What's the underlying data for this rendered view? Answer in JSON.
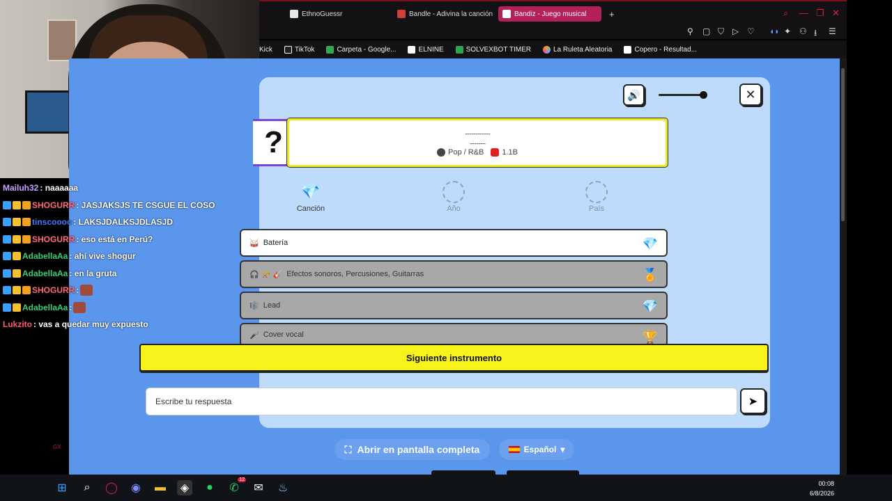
{
  "browser": {
    "tabs": [
      {
        "label": "EthnoGuessr",
        "color": "#e8e8e8"
      },
      {
        "label": "Bandle - Adivina la canción",
        "color": "#d04040"
      },
      {
        "label": "Bandiz - Juego musical",
        "color": "#ffffff"
      }
    ],
    "new_tab_symbol": "+",
    "bookmarks": [
      {
        "label": "Kick",
        "color": "#1a1a1a"
      },
      {
        "label": "TikTok",
        "color": "#ffffff"
      },
      {
        "label": "Carpeta - Google...",
        "color": "#34a853"
      },
      {
        "label": "ELNINE",
        "color": "#ffffff"
      },
      {
        "label": "SOLVEXBOT TIMER",
        "color": "#2ea44f"
      },
      {
        "label": "La Ruleta Aleatoria",
        "color": "#f4a020"
      },
      {
        "label": "Copero - Resultad...",
        "color": "#ffffff"
      }
    ]
  },
  "game": {
    "mystery_mark": "?",
    "song_title_hidden": "........................",
    "song_artist_hidden": "...............",
    "genre": "Pop / R&B",
    "views": "1.1B",
    "steps": [
      {
        "label": "Canción",
        "state": "done",
        "icon": "diamond-icon"
      },
      {
        "label": "Año",
        "state": "pending"
      },
      {
        "label": "País",
        "state": "pending"
      }
    ],
    "instruments": [
      {
        "label": "Batería",
        "icons": "🥁",
        "state": "revealed",
        "end": "💎"
      },
      {
        "label": "Efectos sonoros, Percusiones, Guitarras",
        "icons": "🎧 📯 🎸",
        "state": "locked",
        "end": "🏅"
      },
      {
        "label": "Lead",
        "icons": "🎼",
        "state": "locked",
        "end": "💎"
      },
      {
        "label": "Cover vocal",
        "icons": "🎤",
        "state": "locked",
        "end": "🏆"
      }
    ],
    "next_button": "Siguiente instrumento",
    "answer_placeholder": "Escribe tu respuesta",
    "send_symbol": "➤",
    "fullscreen_button": "Abrir en pantalla completa",
    "language": "Español",
    "close_symbol": "✕",
    "volume_symbol": "🔊",
    "volume_level": 0.98,
    "accent_yellow": "#f7f21a",
    "page_blue": "#5a96ec"
  },
  "chat": {
    "messages": [
      {
        "user": "Mailuh32",
        "color": "#c9a0ff",
        "text": ": naaaaaa",
        "badges": 0
      },
      {
        "user": "SHOGURR",
        "color": "#ff6a78",
        "text": ": JASJAKSJS TE CSGUE EL COSO",
        "badges": 3
      },
      {
        "user": "tinscoooo",
        "color": "#3a7bff",
        "text": ": LAKSJDALKSJDLASJD",
        "badges": 3
      },
      {
        "user": "SHOGURR",
        "color": "#ff6a78",
        "text": ": eso está en Perú?",
        "badges": 3
      },
      {
        "user": "AdabellaAa",
        "color": "#33d07a",
        "text": ": ahí vive shogur",
        "badges": 2
      },
      {
        "user": "AdabellaAa",
        "color": "#33d07a",
        "text": ": en la gruta",
        "badges": 2
      },
      {
        "user": "SHOGURR",
        "color": "#ff6a78",
        "text": ":",
        "badges": 3,
        "emote": true
      },
      {
        "user": "AdabellaAa",
        "color": "#33d07a",
        "text": ":",
        "badges": 2,
        "emote": true
      },
      {
        "user": "Lukzito",
        "color": "#ff5a70",
        "text": ": vas a quedar muy expuesto",
        "badges": 0
      }
    ]
  },
  "taskbar": {
    "time": "00:08",
    "date": "6/8/2026",
    "whatsapp_count": "12"
  },
  "overlay": {
    "gx_label": "GX"
  }
}
